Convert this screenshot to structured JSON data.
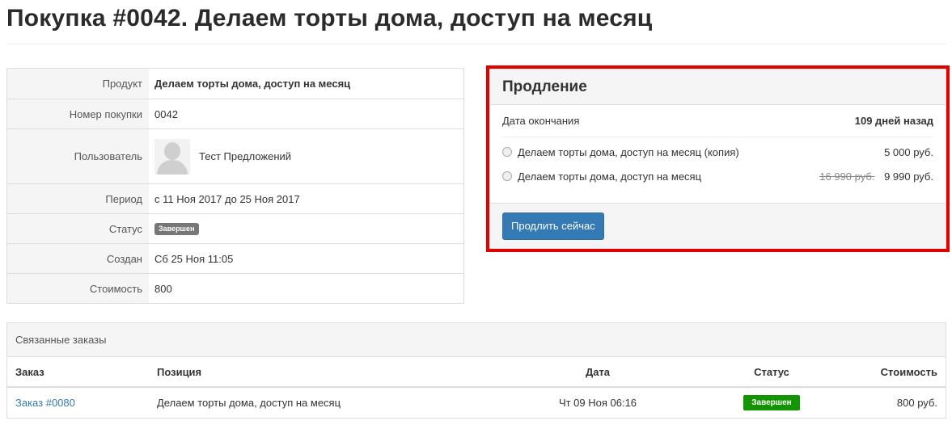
{
  "page": {
    "title": "Покупка #0042. Делаем торты дома, доступ на месяц"
  },
  "details": {
    "product_label": "Продукт",
    "product_value": "Делаем торты дома, доступ на месяц",
    "number_label": "Номер покупки",
    "number_value": "0042",
    "user_label": "Пользователь",
    "user_name": "Тест Предложений",
    "period_label": "Период",
    "period_value": "с 11 Ноя 2017 до 25 Ноя 2017",
    "status_label": "Статус",
    "status_value": "Завершен",
    "created_label": "Создан",
    "created_value": "Сб 25 Ноя 11:05",
    "cost_label": "Стоимость",
    "cost_value": "800"
  },
  "renewal": {
    "title": "Продление",
    "end_label": "Дата окончания",
    "end_value": "109 дней назад",
    "options": [
      {
        "label": "Делаем торты дома, доступ на месяц (копия)",
        "old_price": "",
        "price": "5 000 руб.",
        "selected": false
      },
      {
        "label": "Делаем торты дома, доступ на месяц",
        "old_price": "16 990 руб.",
        "price": "9 990 руб.",
        "selected": false
      }
    ],
    "button_label": "Продлить сейчас",
    "highlight_color": "#e00000"
  },
  "orders": {
    "title": "Связанные заказы",
    "columns": [
      "Заказ",
      "Позиция",
      "Дата",
      "Статус",
      "Стоимость"
    ],
    "rows": [
      {
        "order": "Заказ #0080",
        "position": "Делаем торты дома, доступ на месяц",
        "date": "Чт 09 Ноя 06:16",
        "status": "Завершен",
        "cost": "800 руб."
      }
    ]
  },
  "colors": {
    "link": "#337ab7",
    "primary_button": "#337ab7",
    "status_complete": "#129500",
    "status_grey": "#777777"
  }
}
